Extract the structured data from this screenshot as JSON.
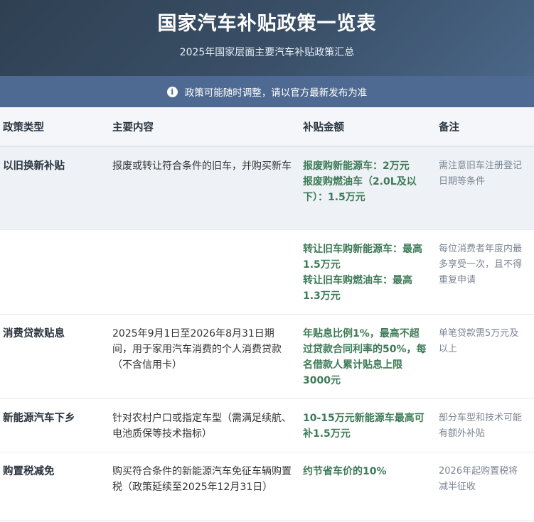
{
  "header": {
    "title": "国家汽车补贴政策一览表",
    "subtitle": "2025年国家层面主要汽车补贴政策汇总"
  },
  "notice": {
    "icon": "info-icon",
    "text": "政策可能随时调整，请以官方最新发布为准"
  },
  "table": {
    "columns": [
      "政策类型",
      "主要内容",
      "补贴金额",
      "备注"
    ],
    "rows": [
      {
        "type": "以旧换新补贴",
        "content": "报废或转让符合条件的旧车，并购买新车",
        "amounts": [
          "报废购新能源车：2万元",
          "报废购燃油车（2.0L及以下）：1.5万元"
        ],
        "note": "需注意旧车注册登记日期等条件"
      },
      {
        "type": "",
        "content": "",
        "amounts": [
          "转让旧车购新能源车：最高1.5万元",
          "转让旧车购燃油车：最高1.3万元"
        ],
        "note": "每位消费者年度内最多享受一次，且不得重复申请"
      },
      {
        "type": "消费贷款贴息",
        "content": "2025年9月1日至2026年8月31日期间，用于家用汽车消费的个人消费贷款（不含信用卡）",
        "amounts": [
          "年贴息比例1%，最高不超过贷款合同利率的50%，每名借款人累计贴息上限3000元"
        ],
        "note": "单笔贷款需5万元及以上"
      },
      {
        "type": "新能源汽车下乡",
        "content": "针对农村户口或指定车型（需满足续航、电池质保等技术指标）",
        "amounts": [
          "10-15万元新能源车最高可补1.5万元"
        ],
        "note": "部分车型和技术可能有额外补贴"
      },
      {
        "type": "购置税减免",
        "content": "购买符合条件的新能源汽车免征车辆购置税（政策延续至2025年12月31日）",
        "amounts": [
          "约节省车价的10%"
        ],
        "note": "2026年起购置税将减半征收"
      }
    ]
  },
  "colors": {
    "header_bg": "#34495e",
    "notice_bg": "#4e6a92",
    "amount_text": "#3e7a56",
    "highlight_row": "#eef2f6"
  }
}
